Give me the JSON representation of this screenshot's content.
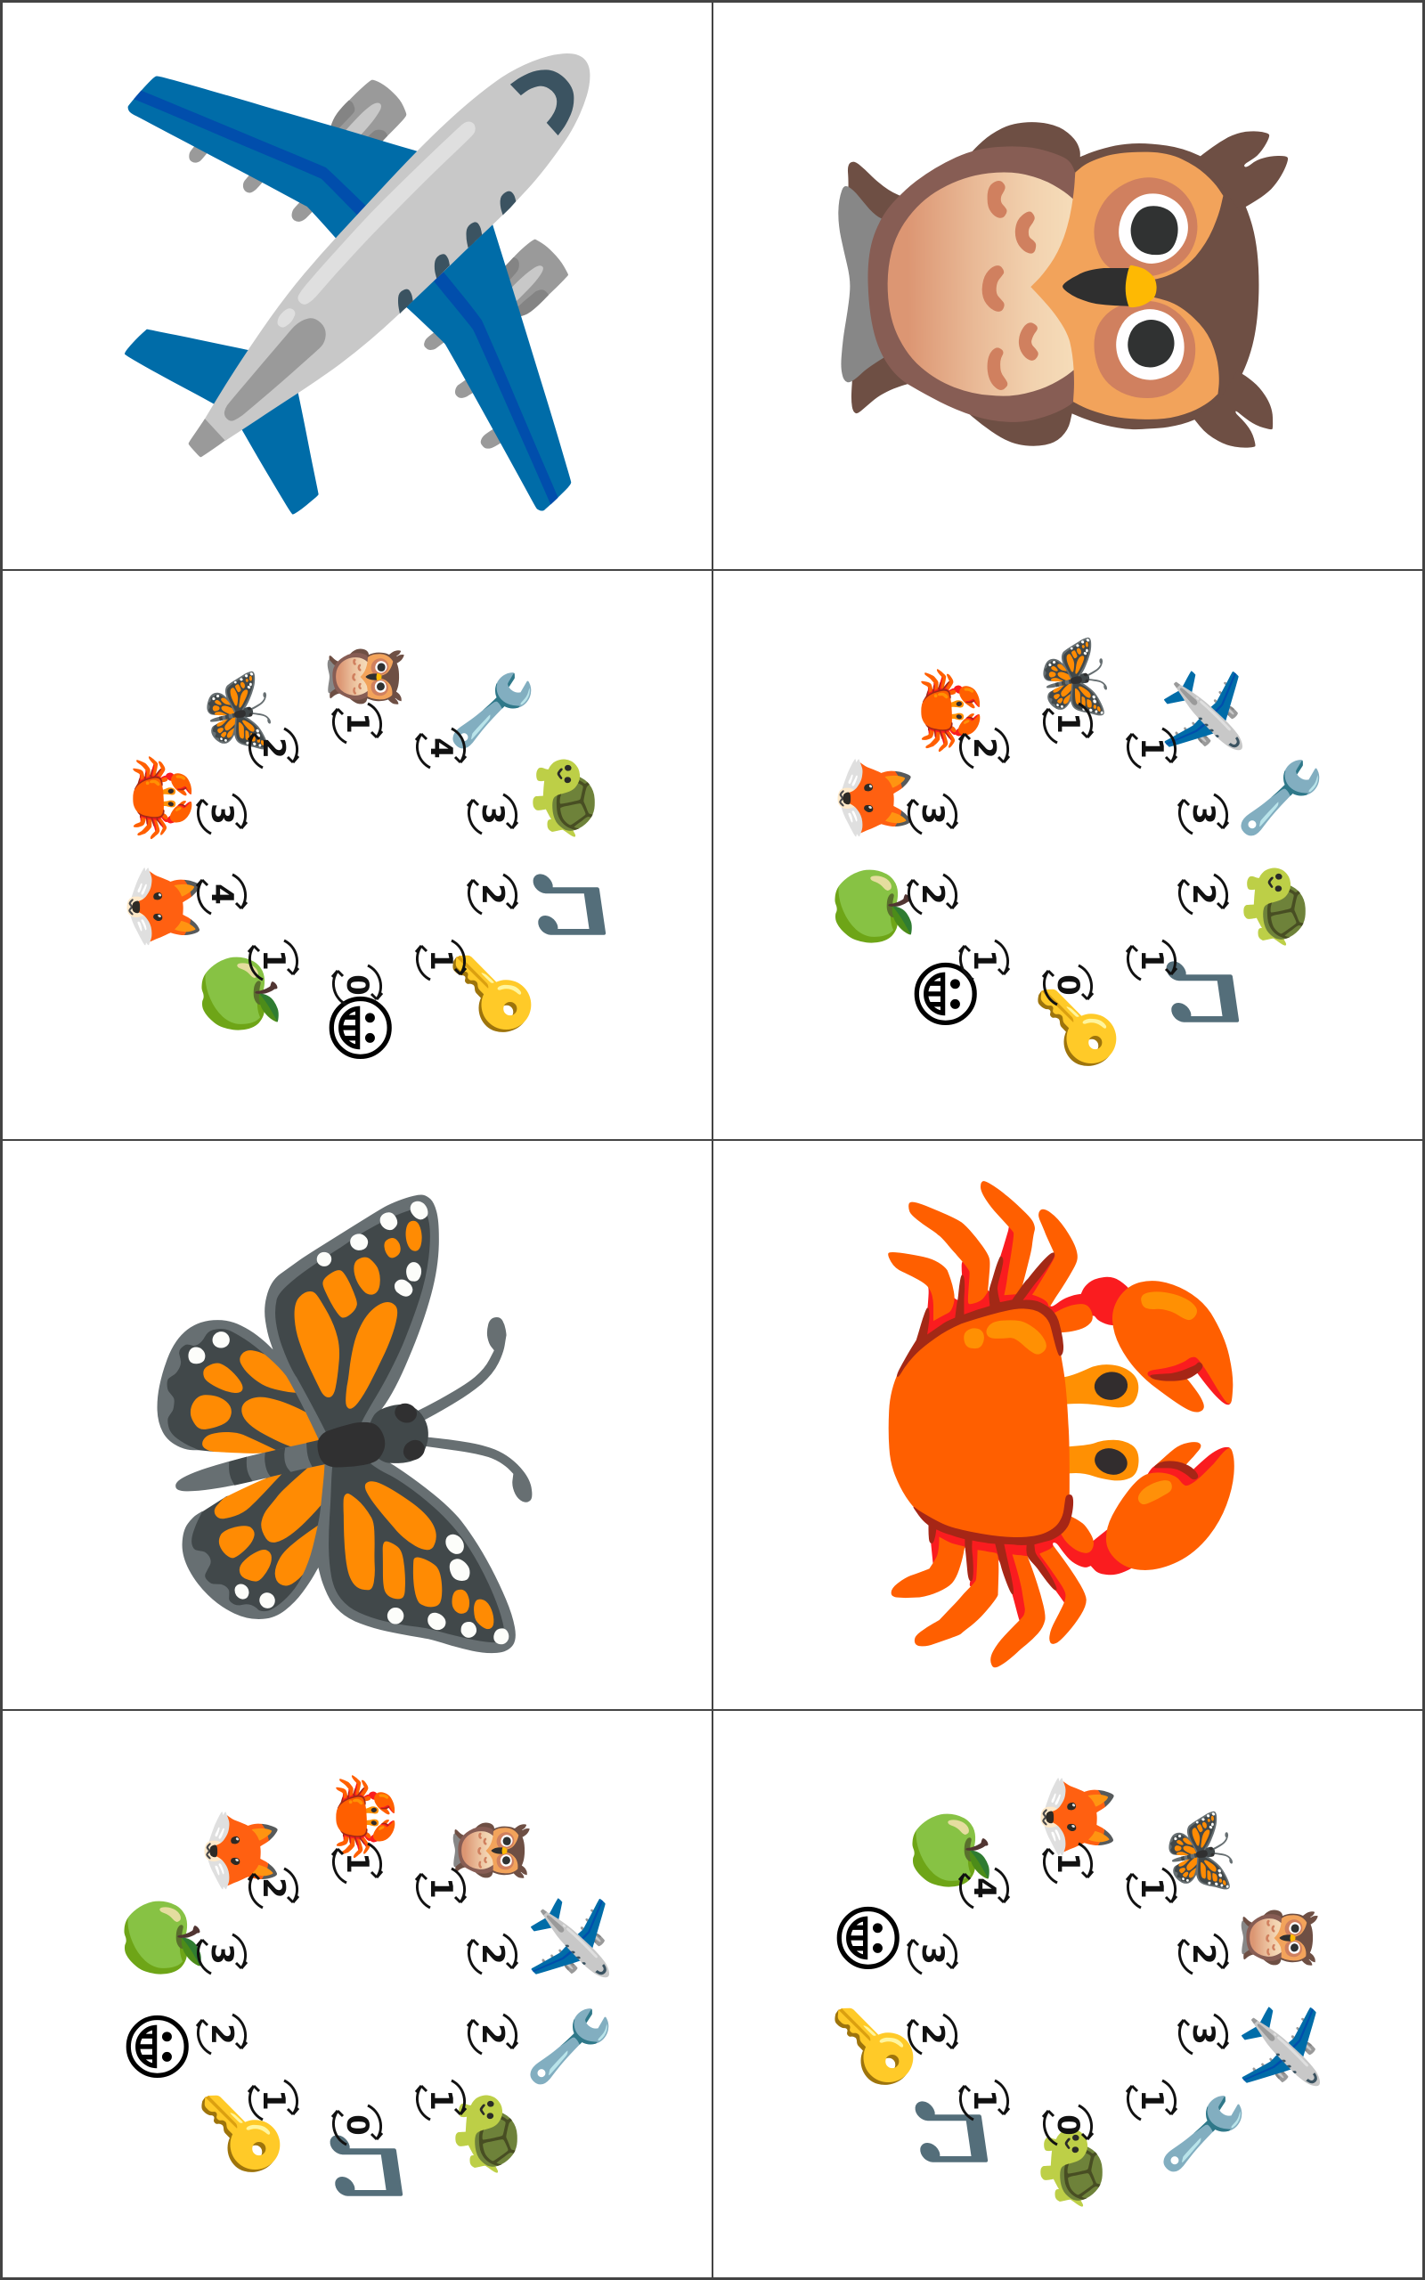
{
  "icons": {
    "airplane": "✈️",
    "owl": "🦉",
    "butterfly": "🦋",
    "crab": "🦀",
    "fox": "🦊",
    "apple": "🍏",
    "smiley": "😀",
    "key": "🔑",
    "wrench": "🔧",
    "turtle": "🐢",
    "music": "🎵"
  },
  "cards": [
    {
      "kind": "single",
      "icon": "airplane",
      "rotation": 0
    },
    {
      "kind": "single",
      "icon": "owl",
      "rotation": 90
    },
    {
      "kind": "ring",
      "symbols": [
        "owl",
        "wrench",
        "turtle",
        "music",
        "key",
        "smiley",
        "apple",
        "fox",
        "crab",
        "butterfly"
      ],
      "numbers": [
        "1",
        "4",
        "3",
        "2",
        "1",
        "0",
        "1",
        "4",
        "3",
        "2"
      ]
    },
    {
      "kind": "ring",
      "symbols": [
        "butterfly",
        "airplane",
        "wrench",
        "turtle",
        "music",
        "key",
        "smiley",
        "apple",
        "fox",
        "crab"
      ],
      "numbers": [
        "1",
        "1",
        "3",
        "2",
        "1",
        "0",
        "1",
        "2",
        "3",
        "2"
      ]
    },
    {
      "kind": "single",
      "icon": "butterfly",
      "rotation": 90
    },
    {
      "kind": "single",
      "icon": "crab",
      "rotation": 90
    },
    {
      "kind": "ring",
      "symbols": [
        "crab",
        "owl",
        "airplane",
        "wrench",
        "turtle",
        "music",
        "key",
        "smiley",
        "apple",
        "fox"
      ],
      "numbers": [
        "1",
        "1",
        "2",
        "2",
        "1",
        "0",
        "1",
        "2",
        "3",
        "2"
      ]
    },
    {
      "kind": "ring",
      "symbols": [
        "fox",
        "butterfly",
        "owl",
        "airplane",
        "wrench",
        "turtle",
        "music",
        "key",
        "smiley",
        "apple"
      ],
      "numbers": [
        "1",
        "1",
        "2",
        "3",
        "1",
        "0",
        "1",
        "2",
        "3",
        "4"
      ]
    }
  ]
}
